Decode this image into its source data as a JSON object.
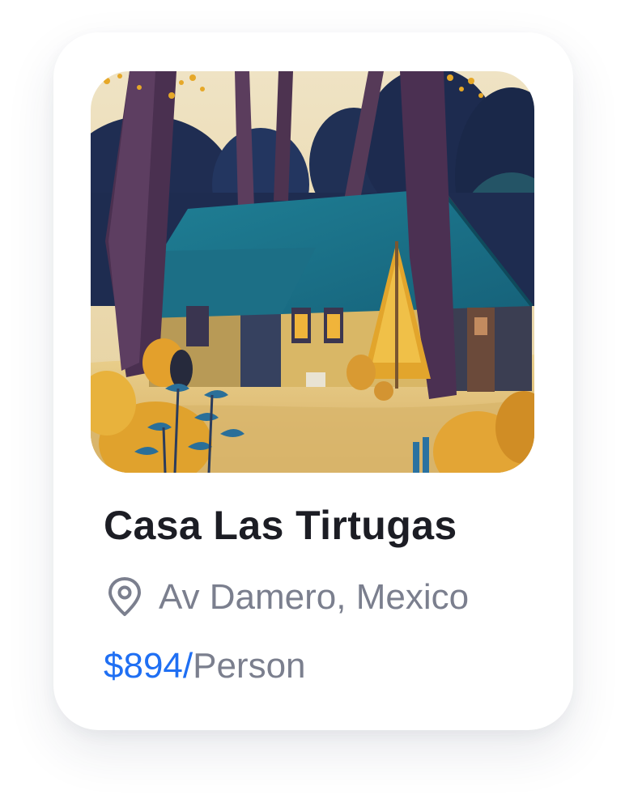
{
  "listing": {
    "title": "Casa Las Tirtugas",
    "location": "Av Damero, Mexico",
    "price": "$894/",
    "price_unit": "Person",
    "location_icon": "map-pin-icon",
    "image": "forest-cabin-illustration"
  },
  "colors": {
    "title": "#1c1d24",
    "muted": "#7b7f8e",
    "accent": "#1f6ff3",
    "card": "#ffffff"
  }
}
